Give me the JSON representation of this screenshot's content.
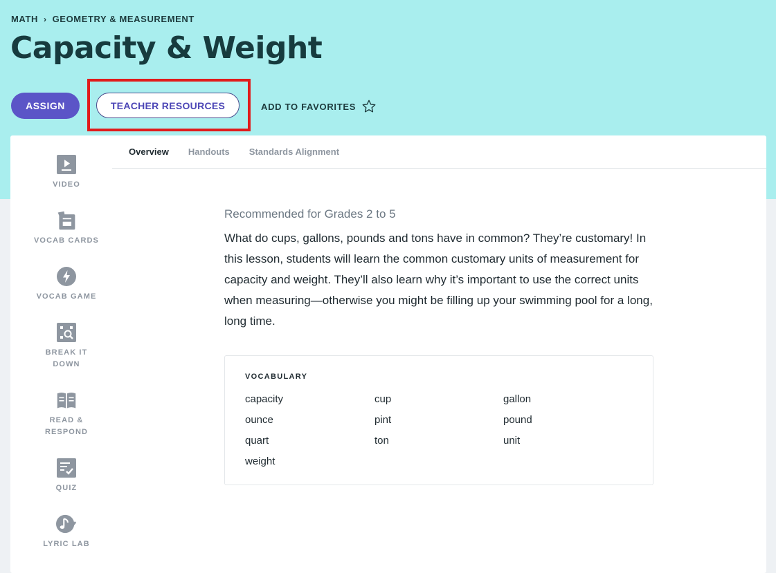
{
  "breadcrumb": {
    "root": "MATH",
    "separator": "›",
    "current": "GEOMETRY & MEASUREMENT"
  },
  "page": {
    "title": "Capacity & Weight"
  },
  "actions": {
    "assign_label": "ASSIGN",
    "teacher_resources_label": "TEACHER RESOURCES",
    "favorites_label": "ADD TO FAVORITES"
  },
  "sidenav": {
    "items": [
      {
        "label": "VIDEO",
        "icon": "video-icon"
      },
      {
        "label": "VOCAB CARDS",
        "icon": "vocab-cards-icon"
      },
      {
        "label": "VOCAB GAME",
        "icon": "lightning-icon"
      },
      {
        "label": "BREAK IT\nDOWN",
        "icon": "break-it-down-icon"
      },
      {
        "label": "READ &\nRESPOND",
        "icon": "open-book-icon"
      },
      {
        "label": "QUIZ",
        "icon": "quiz-checklist-icon"
      },
      {
        "label": "LYRIC LAB",
        "icon": "music-note-icon"
      }
    ]
  },
  "tabs": [
    {
      "label": "Overview",
      "active": true
    },
    {
      "label": "Handouts",
      "active": false
    },
    {
      "label": "Standards Alignment",
      "active": false
    }
  ],
  "overview": {
    "grades": "Recommended for Grades 2 to 5",
    "description": "What do cups, gallons, pounds and tons have in common? They’re customary! In this lesson, students will learn the common customary units of measurement for capacity and weight. They’ll also learn why it’s important to use the correct units when measuring—otherwise you might be filling up your swimming pool for a long, long time."
  },
  "vocabulary": {
    "title": "VOCABULARY",
    "words": [
      "capacity",
      "cup",
      "gallon",
      "ounce",
      "pint",
      "pound",
      "quart",
      "ton",
      "unit",
      "weight"
    ]
  },
  "colors": {
    "hero_bg": "#a9eeee",
    "assign_bg": "#5b55c7",
    "highlight_box": "#e11b1b",
    "nav_icon": "#8e96a0"
  }
}
